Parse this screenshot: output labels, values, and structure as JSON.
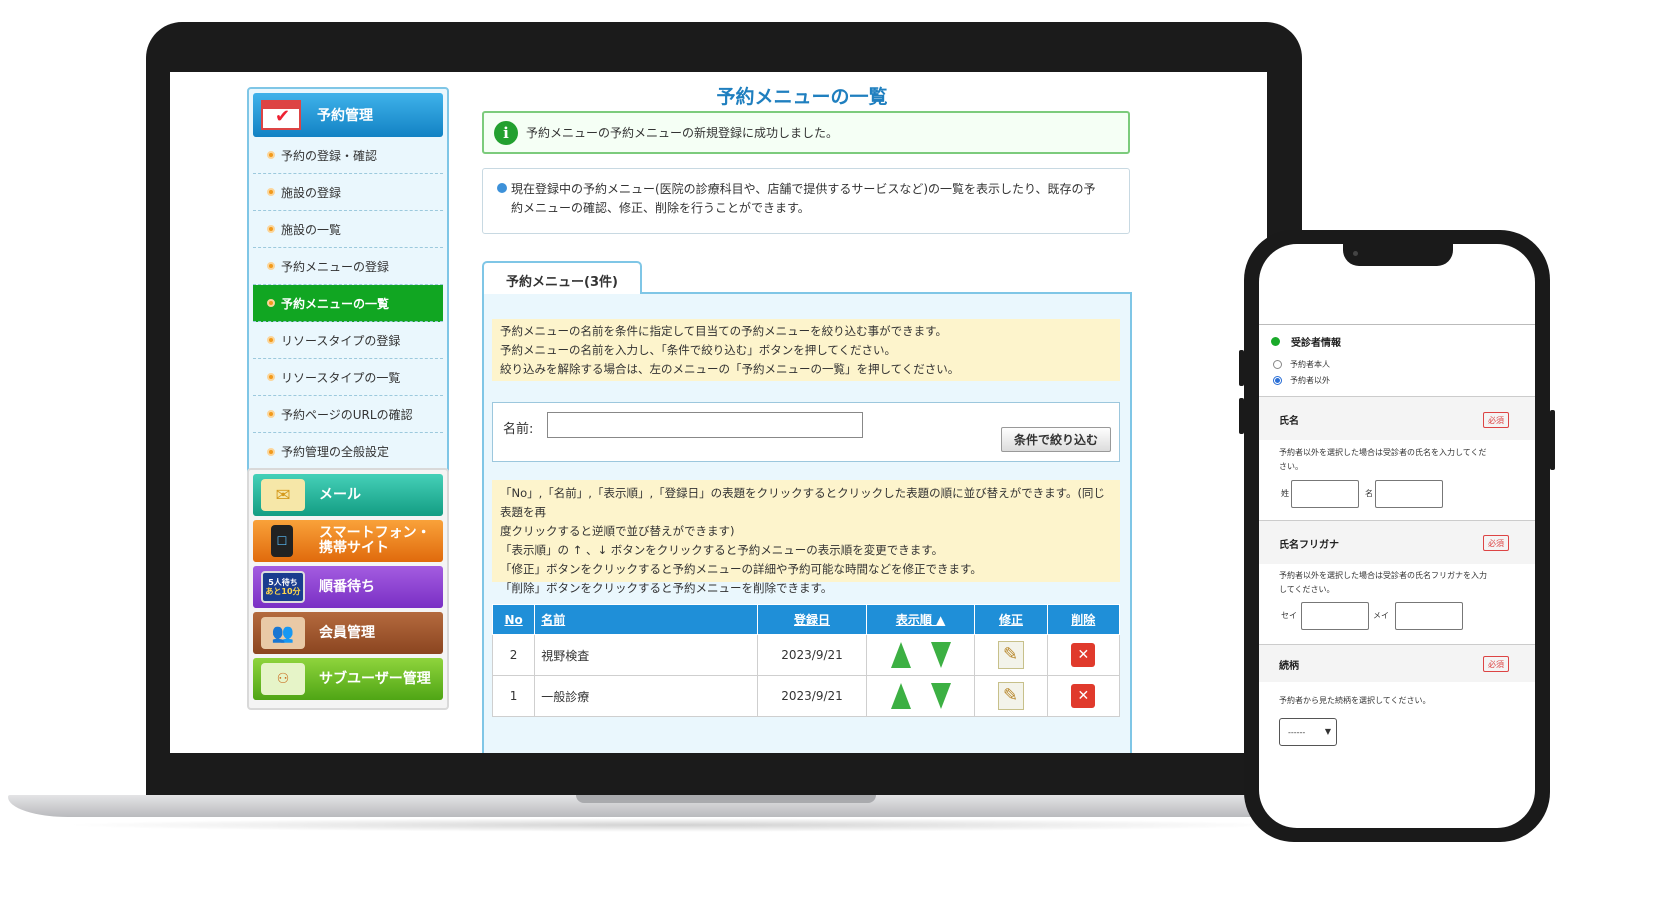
{
  "sidebar": {
    "header": "予約管理",
    "items": [
      {
        "label": "予約の登録・確認"
      },
      {
        "label": "施設の登録"
      },
      {
        "label": "施設の一覧"
      },
      {
        "label": "予約メニューの登録"
      },
      {
        "label": "予約メニューの一覧",
        "active": true
      },
      {
        "label": "リソースタイプの登録"
      },
      {
        "label": "リソースタイプの一覧"
      },
      {
        "label": "予約ページのURLの確認"
      },
      {
        "label": "予約管理の全般設定"
      }
    ],
    "apps": {
      "mail": "メール",
      "phone_line1": "スマートフォン・",
      "phone_line2": "携帯サイト",
      "queue": "順番待ち",
      "queue_icon_line1": "5人待ち",
      "queue_icon_line2": "あと10分",
      "member": "会員管理",
      "subuser": "サブユーザー管理"
    }
  },
  "main": {
    "title": "予約メニューの一覧",
    "success_message": "予約メニューの予約メニューの新規登録に成功しました。",
    "description_line1": "現在登録中の予約メニュー(医院の診療科目や、店舗で提供するサービスなど)の一覧を表示したり、既存の予",
    "description_line2": "約メニューの確認、修正、削除を行うことができます。",
    "tab_label": "予約メニュー(3件)",
    "help1": [
      "予約メニューの名前を条件に指定して目当ての予約メニューを絞り込む事ができます。",
      "予約メニューの名前を入力し、「条件で絞り込む」ボタンを押してください。",
      "絞り込みを解除する場合は、左のメニューの「予約メニューの一覧」を押してください。"
    ],
    "search": {
      "label": "名前:",
      "value": "",
      "button": "条件で絞り込む"
    },
    "help2": [
      "「No」,「名前」,「表示順」,「登録日」の表題をクリックするとクリックした表題の順に並び替えができます。(同じ表題を再",
      "度クリックすると逆順で並び替えができます)",
      "「表示順」の ↑ 、↓ ボタンをクリックすると予約メニューの表示順を変更できます。",
      "「修正」ボタンをクリックすると予約メニューの詳細や予約可能な時間などを修正できます。",
      "「削除」ボタンをクリックすると予約メニューを削除できます。"
    ],
    "table": {
      "headers": [
        "No",
        "名前",
        "登録日",
        "表示順 ▲",
        "修正",
        "削除"
      ],
      "rows": [
        {
          "no": "2",
          "name": "視野検査",
          "date": "2023/9/21"
        },
        {
          "no": "1",
          "name": "一般診療",
          "date": "2023/9/21"
        }
      ]
    }
  },
  "phone": {
    "section_title": "受診者情報",
    "radio_self": "予約者本人",
    "radio_other": "予約者以外",
    "required": "必須",
    "name_label": "氏名",
    "name_help_line1": "予約者以外を選択した場合は受診者の氏名を入力してくだ",
    "name_help_line2": "さい。",
    "sei": "姓",
    "mei": "名",
    "kana_label": "氏名フリガナ",
    "kana_help_line1": "予約者以外を選択した場合は受診者の氏名フリガナを入力",
    "kana_help_line2": "してください。",
    "sei_kana": "セイ",
    "mei_kana": "メイ",
    "relation_label": "続柄",
    "relation_help": "予約者から見た続柄を選択してください。",
    "relation_selected": "------"
  },
  "colors": {
    "accent_blue": "#1f8fd8",
    "active_green": "#11a622",
    "success_border": "#7ccb7c",
    "help_yellow": "#fdf4cc"
  }
}
